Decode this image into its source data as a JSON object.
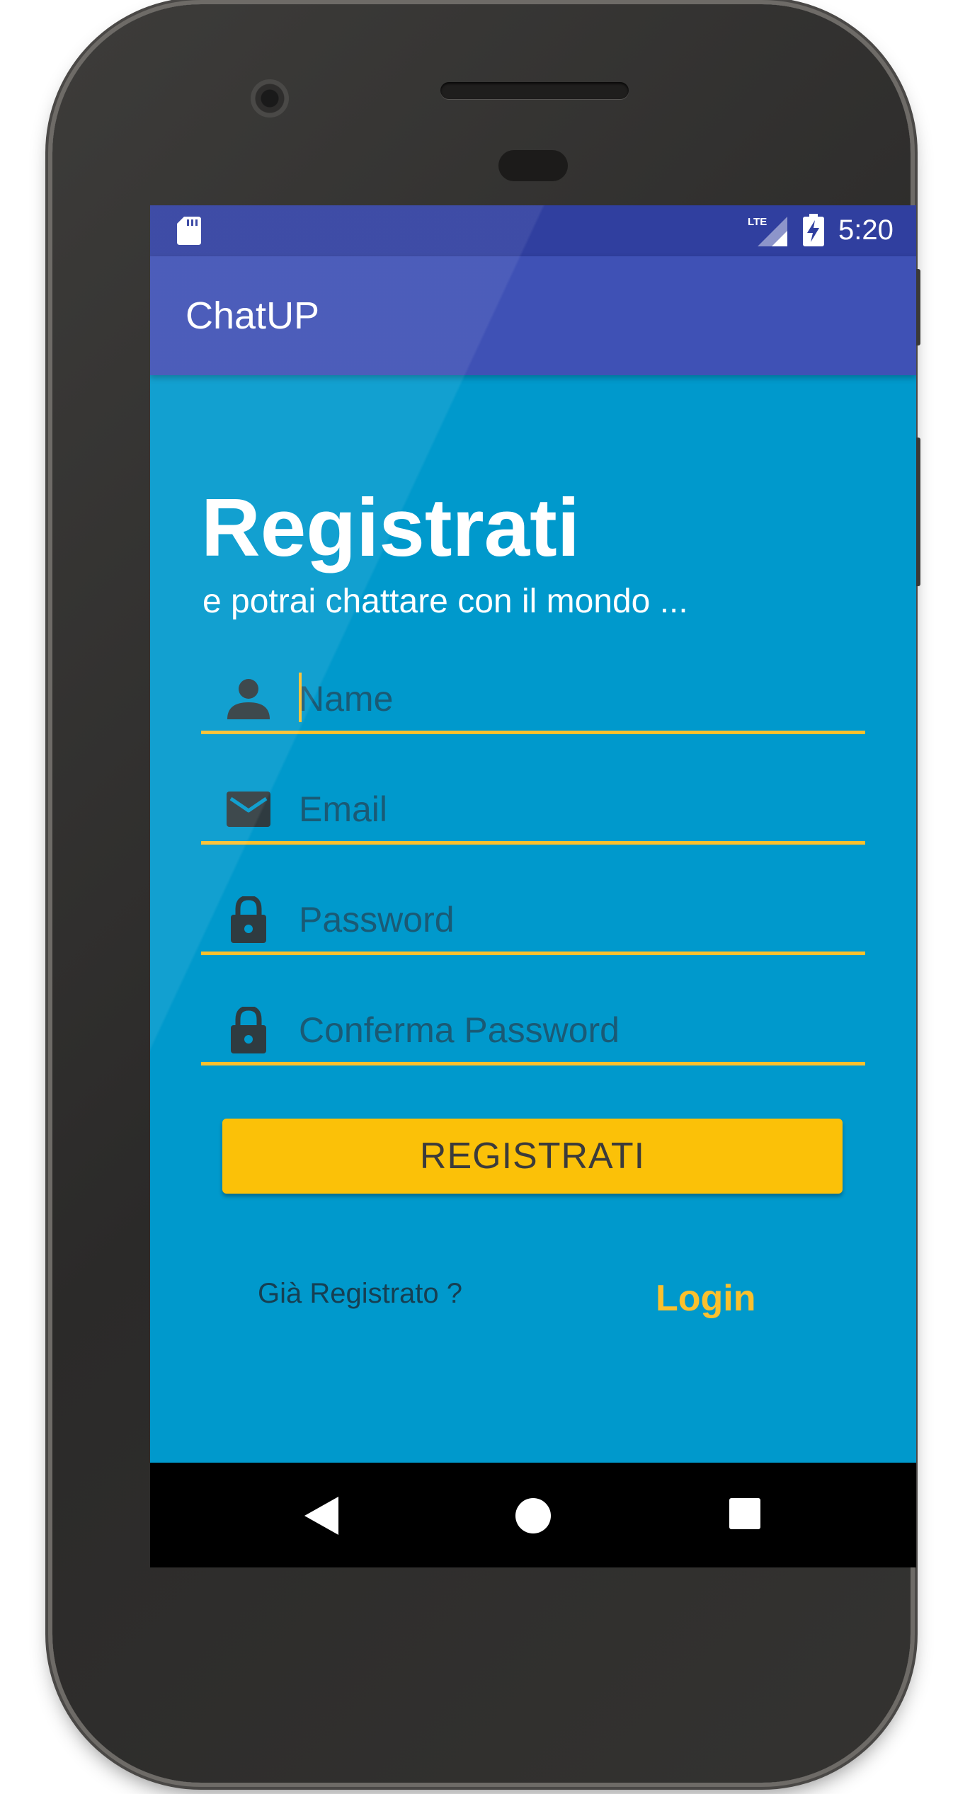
{
  "status_bar": {
    "time": "5:20",
    "network_label": "LTE",
    "icons": [
      "sd-card-icon",
      "lte-signal-icon",
      "battery-charging-icon"
    ]
  },
  "app_bar": {
    "title": "ChatUP"
  },
  "form": {
    "heading": "Registrati",
    "subheading": "e potrai chattare con il mondo ...",
    "name_placeholder": "Name",
    "email_placeholder": "Email",
    "password_placeholder": "Password",
    "confirm_password_placeholder": "Conferma Password",
    "submit_label": "REGISTRATI",
    "already_registered_text": "Già Registrato ?",
    "login_label": "Login"
  },
  "nav_bar": {
    "icons": [
      "back-icon",
      "home-icon",
      "recents-icon"
    ]
  },
  "colors": {
    "status_bar": "#303f9f",
    "app_bar": "#3f51b5",
    "background": "#0099cc",
    "accent": "#fbc02d",
    "button": "#fbc108"
  }
}
